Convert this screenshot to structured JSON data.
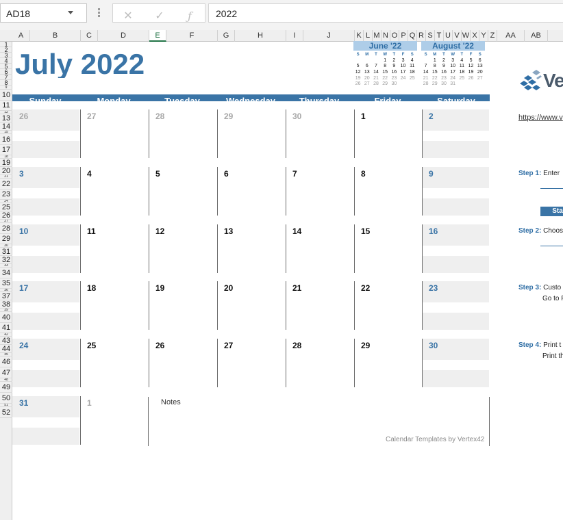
{
  "formula_bar": {
    "name_box": "AD18",
    "formula": "2022",
    "cancel_icon": "close-icon",
    "enter_icon": "check-icon",
    "function_icon": "fx-icon"
  },
  "columns": [
    "A",
    "B",
    "C",
    "D",
    "E",
    "F",
    "G",
    "H",
    "I",
    "J",
    "K",
    "L",
    "M",
    "N",
    "O",
    "P",
    "Q",
    "R",
    "S",
    "T",
    "U",
    "V",
    "W",
    "X",
    "Y",
    "Z",
    "AA",
    "AB"
  ],
  "selected_column": "E",
  "rows": [
    "1",
    "2",
    "3",
    "4",
    "5",
    "6",
    "7",
    "8",
    "9",
    "10",
    "11",
    "12",
    "13",
    "14",
    "15",
    "16",
    "17",
    "18",
    "19",
    "20",
    "21",
    "22",
    "23",
    "24",
    "25",
    "26",
    "27",
    "28",
    "29",
    "30",
    "31",
    "32",
    "33",
    "34",
    "35",
    "36",
    "37",
    "38",
    "39",
    "40",
    "41",
    "42",
    "43",
    "44",
    "45",
    "46",
    "47",
    "48",
    "49",
    "50",
    "51",
    "52"
  ],
  "calendar": {
    "title": "July 2022",
    "day_names": [
      "Sunday",
      "Monday",
      "Tuesday",
      "Wednesday",
      "Thursday",
      "Friday",
      "Saturday"
    ],
    "weeks": [
      [
        "26",
        "27",
        "28",
        "29",
        "30",
        "1",
        "2"
      ],
      [
        "3",
        "4",
        "5",
        "6",
        "7",
        "8",
        "9"
      ],
      [
        "10",
        "11",
        "12",
        "13",
        "14",
        "15",
        "16"
      ],
      [
        "17",
        "18",
        "19",
        "20",
        "21",
        "22",
        "23"
      ],
      [
        "24",
        "25",
        "26",
        "27",
        "28",
        "29",
        "30"
      ],
      [
        "31",
        "1",
        "",
        "",
        "",
        "",
        ""
      ]
    ],
    "notes_label": "Notes",
    "credit": "Calendar Templates by Vertex42"
  },
  "mini_calendars": [
    {
      "title": "June '22",
      "dow": [
        "S",
        "M",
        "T",
        "W",
        "T",
        "F",
        "S"
      ],
      "days": [
        "",
        "",
        "",
        "1",
        "2",
        "3",
        "4",
        "5",
        "6",
        "7",
        "8",
        "9",
        "10",
        "11",
        "12",
        "13",
        "14",
        "15",
        "16",
        "17",
        "18",
        "19",
        "20",
        "21",
        "22",
        "23",
        "24",
        "25",
        "26",
        "27",
        "28",
        "29",
        "30",
        "",
        "",
        "",
        "",
        "",
        "",
        "",
        "",
        "",
        ""
      ]
    },
    {
      "title": "August '22",
      "dow": [
        "S",
        "M",
        "T",
        "W",
        "T",
        "F",
        "S"
      ],
      "days": [
        "",
        "1",
        "2",
        "3",
        "4",
        "5",
        "6",
        "7",
        "8",
        "9",
        "10",
        "11",
        "12",
        "13",
        "14",
        "15",
        "16",
        "17",
        "18",
        "19",
        "20",
        "21",
        "22",
        "23",
        "24",
        "25",
        "26",
        "27",
        "28",
        "29",
        "30",
        "31",
        "",
        "",
        "",
        "",
        "",
        "",
        "",
        "",
        "",
        ""
      ]
    }
  ],
  "side_panel": {
    "logo_text": "Ve",
    "link": "https://www.v",
    "step1": {
      "label": "Step 1:",
      "text": "Enter"
    },
    "start_button": "Sta",
    "step2": {
      "label": "Step 2:",
      "text": "Choos"
    },
    "step3": {
      "label": "Step 3:",
      "text": "Custo",
      "sub": "Go to F"
    },
    "step4": {
      "label": "Step 4:",
      "text": "Print t",
      "sub": "Print th"
    }
  },
  "colors": {
    "accent": "#3a74a6",
    "mini_header": "#aecde8",
    "shade": "#efefef"
  }
}
